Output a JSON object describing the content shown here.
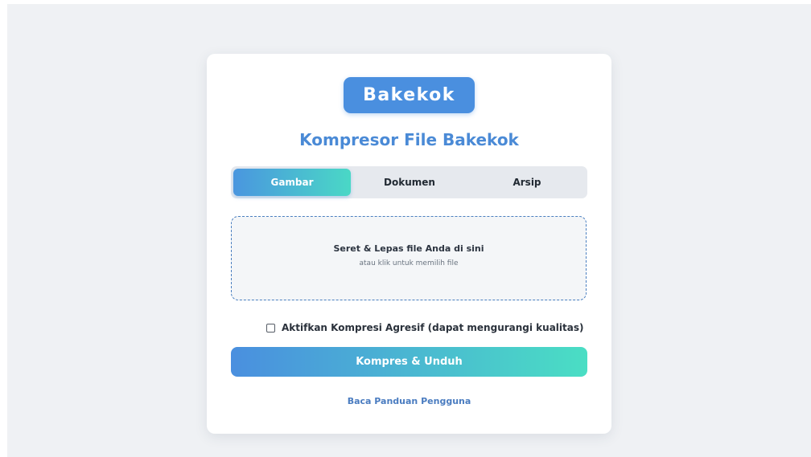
{
  "brand": {
    "logo_text": "Bakekok"
  },
  "page": {
    "title": "Kompresor File Bakekok"
  },
  "tabs": [
    {
      "label": "Gambar",
      "active": true
    },
    {
      "label": "Dokumen",
      "active": false
    },
    {
      "label": "Arsip",
      "active": false
    }
  ],
  "dropzone": {
    "primary_text": "Seret & Lepas file Anda di sini",
    "secondary_text": "atau klik untuk memilih file"
  },
  "options": {
    "aggressive_label": "Aktifkan Kompresi Agresif (dapat mengurangi kualitas)",
    "aggressive_checked": false
  },
  "actions": {
    "compress_label": "Kompres & Unduh",
    "guide_link": "Baca Panduan Pengguna"
  },
  "colors": {
    "accent": "#4a8fdf",
    "gradient_end": "#4adec4",
    "background": "#eff1f4"
  },
  "icons": {
    "checkbox": "checkbox-unchecked-icon"
  }
}
